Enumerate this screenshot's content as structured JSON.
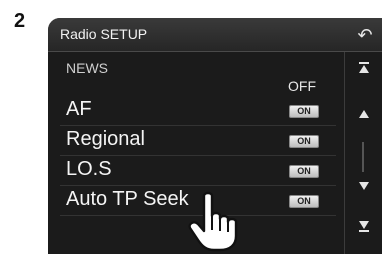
{
  "step": {
    "number": "2"
  },
  "title_bar": {
    "title": "Radio SETUP",
    "back_icon": "back-arrow-icon"
  },
  "news": {
    "label": "NEWS",
    "value": "OFF"
  },
  "settings": [
    {
      "label": "AF",
      "toggle": "ON"
    },
    {
      "label": "Regional",
      "toggle": "ON"
    },
    {
      "label": "LO.S",
      "toggle": "ON"
    },
    {
      "label": "Auto TP Seek",
      "toggle": "ON"
    }
  ],
  "scroll": {
    "icons": [
      "scroll-to-top-icon",
      "scroll-up-icon",
      "scroll-down-icon",
      "scroll-to-bottom-icon"
    ]
  },
  "pointer": {
    "icon": "hand-pointer-icon"
  },
  "colors": {
    "background": "#1b1b1b",
    "title_bar": "#2e2e2e",
    "text": "#f4f4f4",
    "toggle": "#d9d9d9"
  }
}
